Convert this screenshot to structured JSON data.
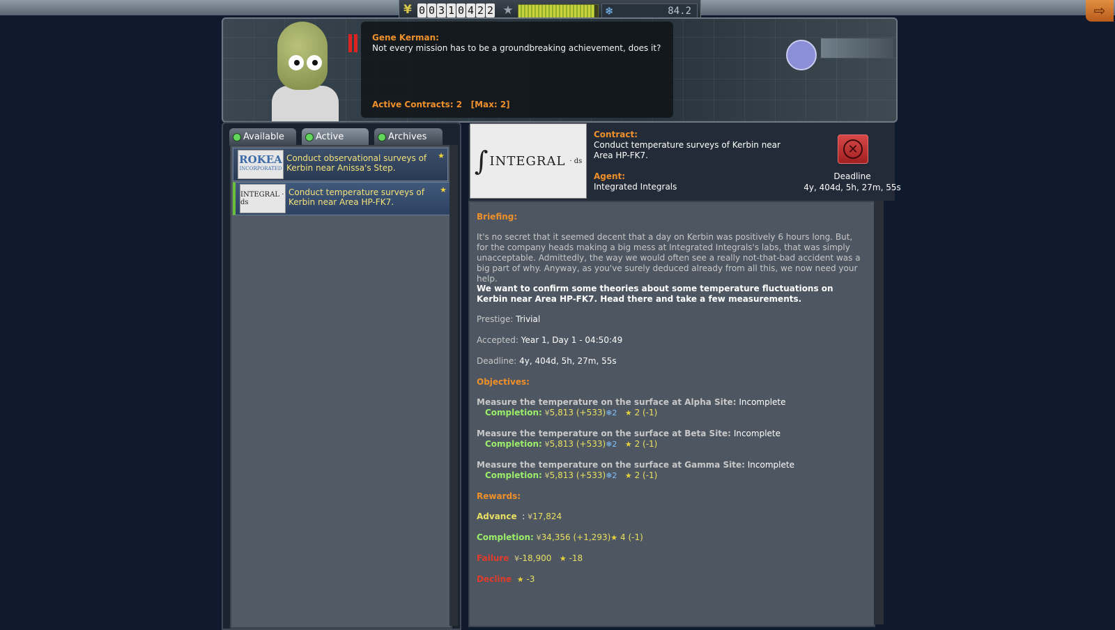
{
  "topbar": {
    "funds_digits": [
      "0",
      "0",
      "3",
      "1",
      "0",
      "4",
      "2",
      "2"
    ],
    "reputation_fill": 0.96,
    "science": "84.2",
    "icons": {
      "funds": "funds-icon",
      "reputation": "star-icon",
      "science": "atom-icon",
      "exit": "exit-icon"
    }
  },
  "banner": {
    "speaker": "Gene Kerman:",
    "speech": "Not every mission has to be a groundbreaking achievement, does it?",
    "active_contracts": "Active Contracts: 2   [Max: 2]"
  },
  "tabs": [
    {
      "label": "Available"
    },
    {
      "label": "Active"
    },
    {
      "label": "Archives"
    }
  ],
  "contracts": [
    {
      "agency_logo_text": "ROKEA",
      "agency_logo_sub": "INCORPORATED",
      "title": "Conduct observational surveys of Kerbin near Anissa's Step."
    },
    {
      "agency_logo_text": "INTEGRAL · ds",
      "title": "Conduct temperature surveys of Kerbin near Area HP-FK7."
    }
  ],
  "detail_header": {
    "logo": {
      "f": "∫",
      "word": "INTEGRAL",
      "ds": "· ds"
    },
    "contract_label": "Contract:",
    "contract_value": "Conduct temperature surveys of Kerbin near Area HP-FK7.",
    "agent_label": "Agent:",
    "agent_value": "Integrated Integrals",
    "deadline_label": "Deadline",
    "deadline_value": "4y, 404d, 5h, 27m, 55s"
  },
  "detail": {
    "briefing_label": "Briefing:",
    "briefing": "It's no secret that it seemed decent that a day on Kerbin was positively 6 hours long. But, for the company heads making a big mess at Integrated Integrals's labs, that was simply unacceptable. Admittedly, the way we would often see a really not-that-bad accident was a big part of why. Anyway, as you've surely deduced already from all this, we now need your help.",
    "synopsis": "We want to confirm some theories about some temperature fluctuations on Kerbin near Area HP-FK7. Head there and take a few measurements.",
    "prestige_label": "Prestige:",
    "prestige_value": "Trivial",
    "accepted_label": "Accepted:",
    "accepted_value": "Year 1, Day 1 - 04:50:49",
    "deadline_label": "Deadline:",
    "deadline_value": "4y, 404d, 5h, 27m, 55s",
    "objectives_label": "Objectives:",
    "objectives": [
      {
        "text": "Measure the temperature on the surface at Alpha Site:",
        "status": "Incomplete",
        "completion_label": "Completion:",
        "funds": "5,813",
        "funds_bonus": "(+533)",
        "science": "2",
        "rep": "2",
        "rep_mod": "(-1)"
      },
      {
        "text": "Measure the temperature on the surface at Beta Site:",
        "status": "Incomplete",
        "completion_label": "Completion:",
        "funds": "5,813",
        "funds_bonus": "(+533)",
        "science": "2",
        "rep": "2",
        "rep_mod": "(-1)"
      },
      {
        "text": "Measure the temperature on the surface at Gamma Site:",
        "status": "Incomplete",
        "completion_label": "Completion:",
        "funds": "5,813",
        "funds_bonus": "(+533)",
        "science": "2",
        "rep": "2",
        "rep_mod": "(-1)"
      }
    ],
    "rewards_label": "Rewards:",
    "advance_label": "Advance",
    "advance_value": "17,824",
    "completion_label": "Completion:",
    "completion_funds": "34,356",
    "completion_funds_bonus": "(+1,293)",
    "completion_rep": "4",
    "completion_rep_mod": "(-1)",
    "failure_label": "Failure",
    "failure_funds": "-18,900",
    "failure_rep": "-18",
    "decline_label": "Decline",
    "decline_rep": "-3"
  }
}
